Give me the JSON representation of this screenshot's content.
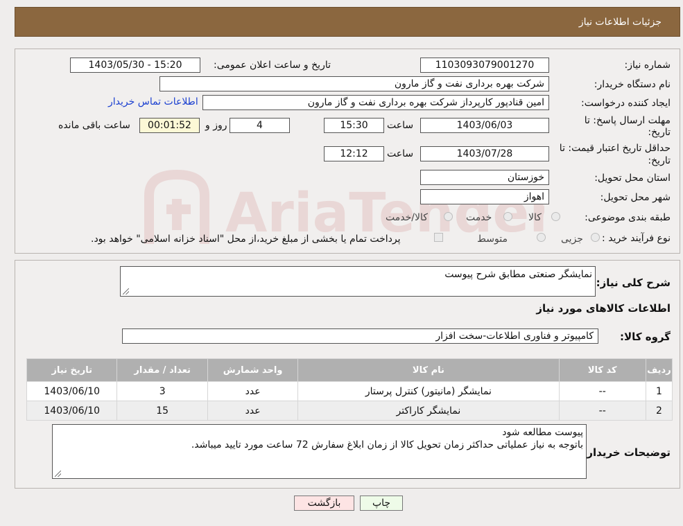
{
  "header": {
    "title": "جزئیات اطلاعات نیاز"
  },
  "form": {
    "need_number_label": "شماره نیاز:",
    "need_number": "1103093079001270",
    "announce_label": "تاریخ و ساعت اعلان عمومی:",
    "announce_value": "1403/05/30 - 15:20",
    "buyer_org_label": "نام دستگاه خریدار:",
    "buyer_org": "شرکت بهره برداری نفت و گاز مارون",
    "creator_label": "ایجاد کننده درخواست:",
    "creator": "امین قنادپور کارپرداز شرکت بهره برداری نفت و گاز مارون",
    "contact_link": "اطلاعات تماس خریدار",
    "deadline_label_1": "مهلت ارسال پاسخ: تا",
    "deadline_label_2": "تاریخ:",
    "deadline_date": "1403/06/03",
    "time_label": "ساعت",
    "deadline_time": "15:30",
    "days_value": "4",
    "days_label": "روز و",
    "remaining_value": "00:01:52",
    "remaining_label": "ساعت باقی مانده",
    "price_validity_label_1": "حداقل تاریخ اعتبار قیمت: تا",
    "price_validity_label_2": "تاریخ:",
    "price_validity_date": "1403/07/28",
    "price_validity_time": "12:12",
    "province_label": "استان محل تحویل:",
    "province": "خوزستان",
    "city_label": "شهر محل تحویل:",
    "city": "اهواز",
    "category_label": "طبقه بندی موضوعی:",
    "category_options": [
      "کالا",
      "خدمت",
      "کالا/خدمت"
    ],
    "purchase_type_label": "نوع فرآیند خرید :",
    "purchase_options": [
      "جزیی",
      "متوسط"
    ],
    "payment_note": "پرداخت تمام یا بخشی از مبلغ خرید،از محل \"اسناد خزانه اسلامی\" خواهد بود."
  },
  "details": {
    "summary_label": "شرح کلی نیاز:",
    "summary": "نمایشگر صنعتی مطابق شرح پیوست",
    "goods_info_title": "اطلاعات کالاهای مورد نیاز",
    "goods_group_label": "گروه کالا:",
    "goods_group": "کامپیوتر و فناوری اطلاعات-سخت افزار",
    "table": {
      "headers": [
        "ردیف",
        "کد کالا",
        "نام کالا",
        "واحد شمارش",
        "تعداد / مقدار",
        "تاریخ نیاز"
      ],
      "rows": [
        [
          "1",
          "--",
          "نمایشگر (مانیتور) کنترل پرستار",
          "عدد",
          "3",
          "1403/06/10"
        ],
        [
          "2",
          "--",
          "نمایشگر کاراکتر",
          "عدد",
          "15",
          "1403/06/10"
        ]
      ]
    },
    "buyer_notes_label": "توضیحات خریدار:",
    "buyer_notes_line1": "پیوست مطالعه شود",
    "buyer_notes_line2": "باتوجه به نیاز عملیاتی حداکثر زمان تحویل کالا از زمان ابلاغ سفارش 72 ساعت مورد تایید میباشد."
  },
  "buttons": {
    "print": "چاپ",
    "back": "بازگشت"
  },
  "watermark": {
    "text": "AriaTender.neT"
  },
  "colors": {
    "header_bg": "#8b673f",
    "link": "#1a3fd0",
    "table_header": "#b0b0b0",
    "print_btn": "#eefbe8",
    "back_btn": "#fde4e4"
  }
}
